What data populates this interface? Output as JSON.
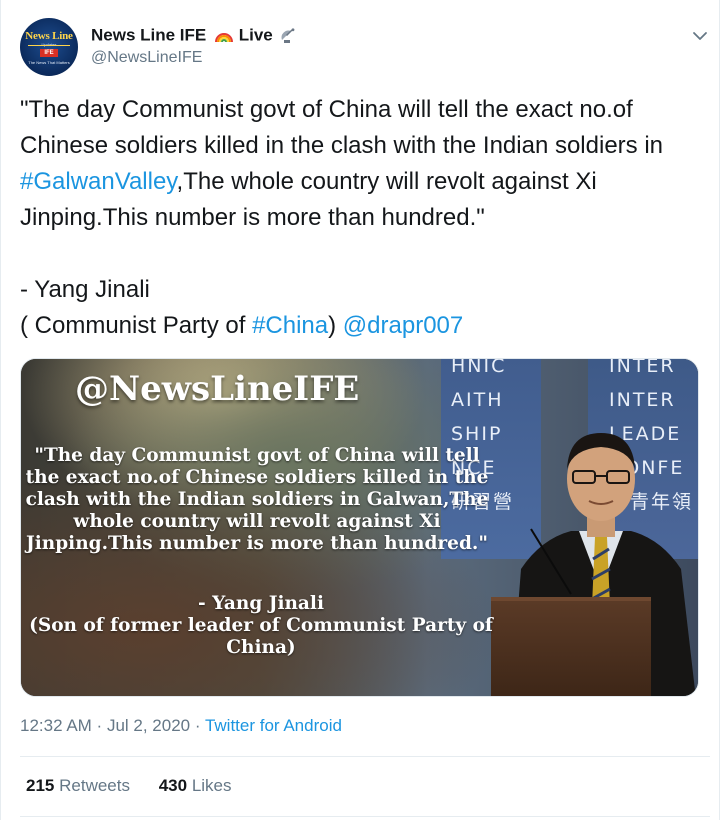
{
  "author": {
    "avatar": {
      "top": "News Line",
      "small": "Updates",
      "ife": "IFE",
      "tag": "The News That Matters"
    },
    "display_name": "News Line IFE",
    "suffix_text": "Live",
    "handle": "@NewsLineIFE"
  },
  "tweet": {
    "line1": "\"The day Communist govt of China will tell the exact no.of Chinese soldiers killed in the clash with the Indian soldiers in ",
    "hashtag1": "#GalwanValley",
    "line1_end": ",The whole country will revolt against Xi Jinping.This number is more than hundred.\"",
    "attribution": "- Yang Jinali",
    "party_prefix": "( Communist Party of ",
    "hashtag2": "#China",
    "party_suffix": ") ",
    "mention": "@drapr007"
  },
  "image": {
    "brand": "@NewsLineIFE",
    "quote": "\"The day Communist govt of China will tell the exact no.of Chinese soldiers killed in the clash with the Indian soldiers in Galwan,The whole country will revolt against Xi Jinping.This number is more than hundred.\"",
    "attribution_line1": "- Yang Jinali",
    "attribution_line2": "(Son of former leader of Communist Party of China)",
    "banner_mid": "HNIC\nAITH\nSHIP\nNCE\n研習營",
    "banner_right": "INTER\nINTER\nLEADE\nCONFE\n聯青年領"
  },
  "meta": {
    "time": "12:32 AM",
    "separator": " · ",
    "date": "Jul 2, 2020",
    "source": "Twitter for Android"
  },
  "stats": {
    "retweets_count": "215",
    "retweets_label": "Retweets",
    "likes_count": "430",
    "likes_label": "Likes"
  },
  "icons": {
    "rainbow": "rainbow-icon",
    "satellite": "satellite-icon",
    "menu": "chevron-down-icon"
  },
  "colors": {
    "link": "#1b95e0",
    "secondary": "#657786",
    "text": "#14171a"
  }
}
